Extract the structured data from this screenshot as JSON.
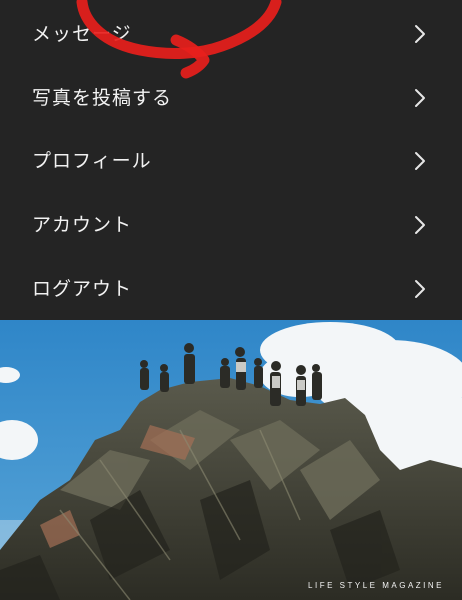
{
  "menu": {
    "items": [
      {
        "label": "メッセージ"
      },
      {
        "label": "写真を投稿する"
      },
      {
        "label": "プロフィール"
      },
      {
        "label": "アカウント"
      },
      {
        "label": "ログアウト"
      }
    ]
  },
  "banner": {
    "caption": "LIFE STYLE MAGAZINE"
  },
  "colors": {
    "menu_background": "#242424",
    "menu_text": "#f2f2f2",
    "annotation": "#e8201c",
    "sky": "#3f93cf"
  },
  "icons": {
    "menu_item_arrow": "chevron-right-icon"
  }
}
